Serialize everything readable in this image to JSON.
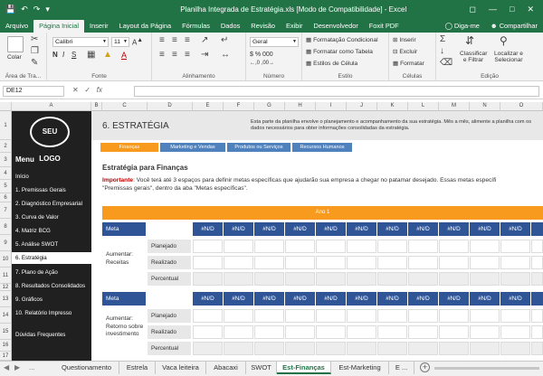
{
  "window": {
    "title": "Planilha Integrada de Estratégia.xls  [Modo de Compatibilidade] - Excel",
    "save_icon": "save-icon",
    "undo_icon": "undo-icon",
    "redo_icon": "redo-icon"
  },
  "menu_tabs": [
    "Arquivo",
    "Página Inicial",
    "Inserir",
    "Layout da Página",
    "Fórmulas",
    "Dados",
    "Revisão",
    "Exibir",
    "Desenvolvedor",
    "Foxit PDF"
  ],
  "active_tab": "Página Inicial",
  "help_label": "Diga-me",
  "share_label": "Compartilhar",
  "ribbon": {
    "clipboard": {
      "paste": "Colar",
      "name": "Área de Tra..."
    },
    "font": {
      "family": "Calibri",
      "size": "11",
      "name": "Fonte"
    },
    "alignment": {
      "name": "Alinhamento"
    },
    "number": {
      "format": "Geral",
      "name": "Número"
    },
    "styles": {
      "cond": "Formatação Condicional",
      "table": "Formatar como Tabela",
      "cell": "Estilos de Célula",
      "name": "Estilo"
    },
    "cells": {
      "insert": "Inserir",
      "delete": "Excluir",
      "format": "Formatar",
      "name": "Células"
    },
    "editing": {
      "sort": "Classificar e Filtrar",
      "find": "Localizar e Selecionar",
      "name": "Edição"
    }
  },
  "formula_bar": {
    "name_box": "DE12",
    "fx": "fx",
    "value": ""
  },
  "columns": [
    "A",
    "B",
    "C",
    "D",
    "E",
    "F",
    "G",
    "H",
    "I",
    "J",
    "K",
    "L",
    "M",
    "N",
    "O"
  ],
  "rows": [
    "1",
    "2",
    "3",
    "4",
    "5",
    "6",
    "7",
    "8",
    "9",
    "10",
    "11",
    "12",
    "13",
    "14",
    "15",
    "16",
    "17"
  ],
  "sidebar": {
    "logo": "SEU LOGO",
    "title": "Menu",
    "items": [
      "Início",
      "1. Premissas Gerais",
      "2. Diagnóstico Empresarial",
      "3. Curva de Valor",
      "4. Matriz BCG",
      "5. Análise SWOT",
      "6. Estratégia",
      "7. Plano de Ação",
      "8. Resultados Consolidados",
      "9. Gráficos",
      "10. Relatório Impresso",
      "Dúvidas Frequentes"
    ],
    "active_index": 6
  },
  "banner": {
    "heading": "6. ESTRATÉGIA",
    "description": "Esta parte da planilha envolve o planejamento e acompanhamento da sua estratégia. Mês a mês, alimente a planilha com os dados necessários para obter informações consolidadas da estratégia."
  },
  "subtabs": [
    "Finanças",
    "Marketing e Vendas",
    "Produtos ou Serviços",
    "Recursos Humanos"
  ],
  "active_subtab": "Finanças",
  "section_title": "Estratégia para Finanças",
  "intro": {
    "label": "Importante",
    "text": ": Você terá até 3 espaços para definir metas específicas que ajudarão sua empresa a chegar no patamar desejado. Essas metas específi",
    "text2": "\"Premissas gerais\", dentro da aba \"Metas específicas\"."
  },
  "year_label": "Ano 1",
  "na_value": "#N/D",
  "meta_tables": [
    {
      "header": "Meta",
      "label": "Aumentar: Receitas",
      "rows": [
        "Planejado",
        "Realizado",
        "Percentual"
      ]
    },
    {
      "header": "Meta",
      "label": "Aumentar: Retorno sobre investimento",
      "rows": [
        "Planejado",
        "Realizado",
        "Percentual"
      ]
    }
  ],
  "sheet_tabs": [
    "Questionamento",
    "Estrela",
    "Vaca leiteira",
    "Abacaxi",
    "SWOT",
    "Est-Finanças",
    "Est-Marketing",
    "E ..."
  ],
  "active_sheet": "Est-Finanças",
  "colors": {
    "excel_green": "#217346",
    "orange": "#f79a1e",
    "blue": "#4f81bd",
    "dark_blue": "#2f5597",
    "sidebar": "#202020"
  }
}
